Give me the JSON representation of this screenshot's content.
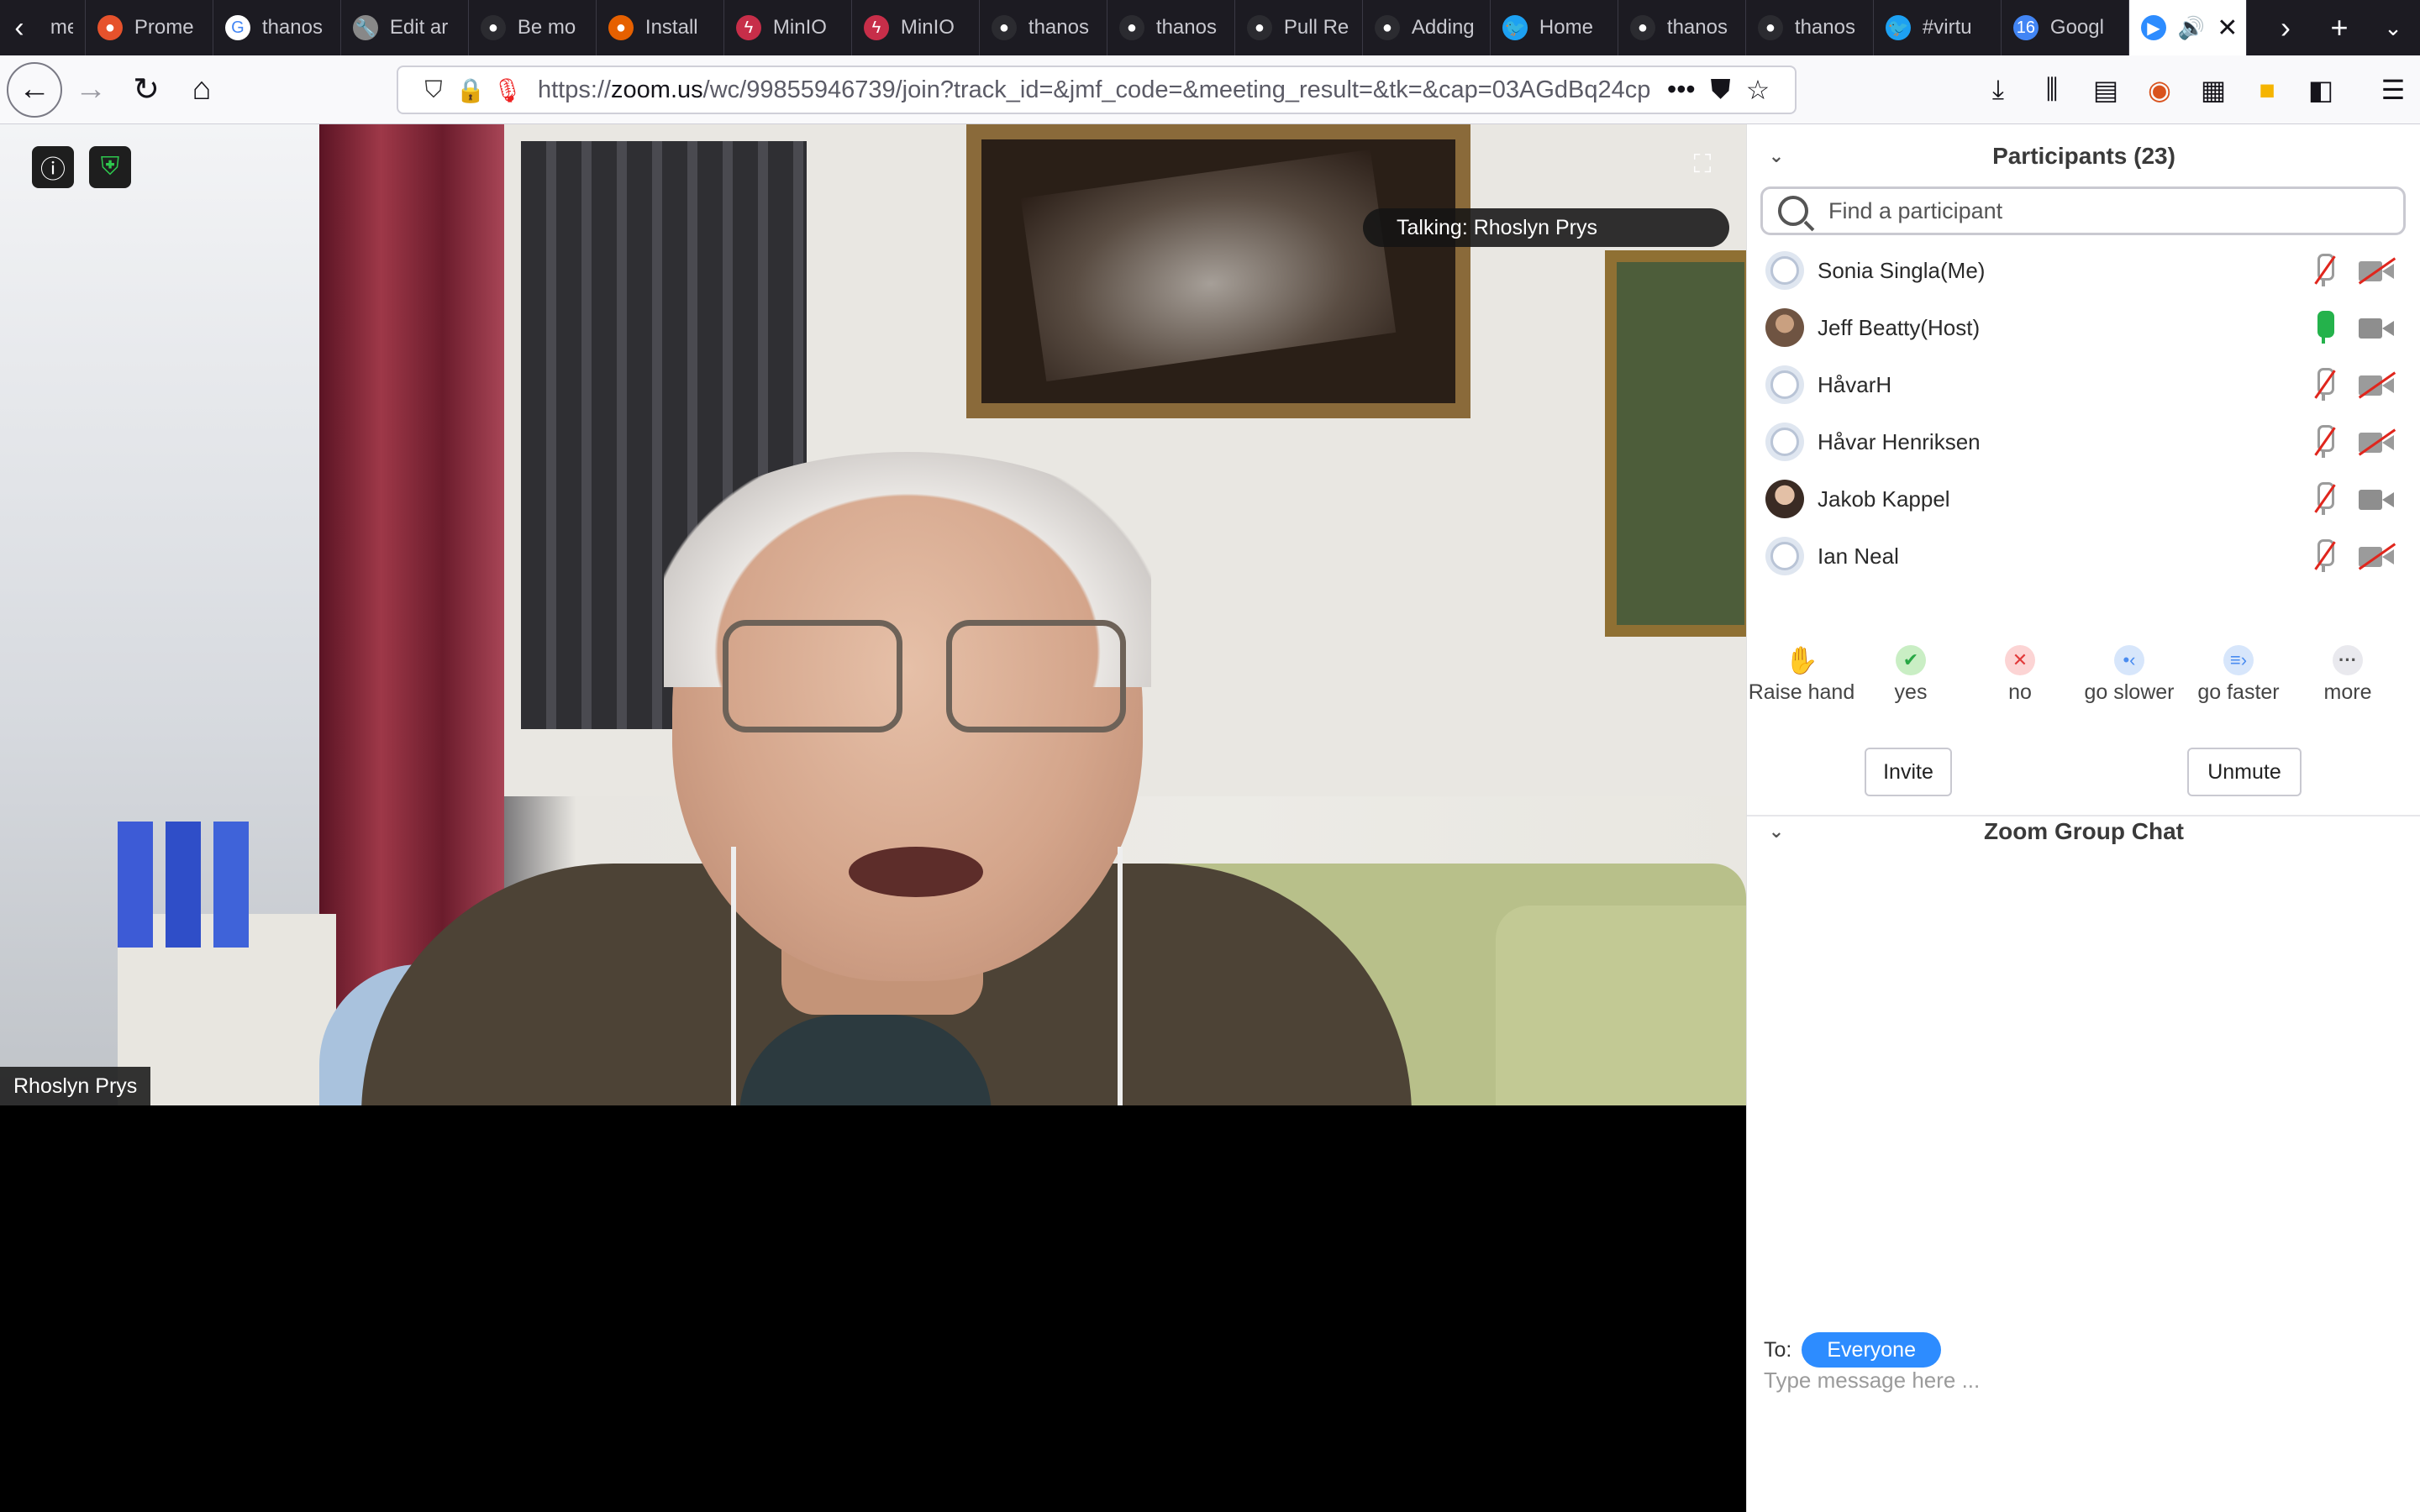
{
  "browser": {
    "tabs": [
      {
        "label": "me",
        "icon": "firefox-icon"
      },
      {
        "label": "Prome",
        "icon": "prometheus-icon"
      },
      {
        "label": "thanos",
        "icon": "google-icon"
      },
      {
        "label": "Edit ar",
        "icon": "wrench-icon"
      },
      {
        "label": "Be mo",
        "icon": "github-icon"
      },
      {
        "label": "Install",
        "icon": "firefox-icon"
      },
      {
        "label": "MinIO",
        "icon": "minio-icon"
      },
      {
        "label": "MinIO",
        "icon": "minio-icon"
      },
      {
        "label": "thanos",
        "icon": "github-icon"
      },
      {
        "label": "thanos",
        "icon": "github-icon"
      },
      {
        "label": "Pull Re",
        "icon": "github-icon"
      },
      {
        "label": "Adding",
        "icon": "github-icon"
      },
      {
        "label": "Home",
        "icon": "twitter-icon"
      },
      {
        "label": "thanos",
        "icon": "github-icon"
      },
      {
        "label": "thanos",
        "icon": "github-icon"
      },
      {
        "label": "#virtu",
        "icon": "twitter-icon"
      },
      {
        "label": "Googl",
        "icon": "calendar-icon"
      }
    ],
    "active_tab": {
      "label": "",
      "icon": "zoom-icon"
    },
    "url_prefix": "https://",
    "url_domain": "zoom.us",
    "url_rest": "/wc/99855946739/join?track_id=&jmf_code=&meeting_result=&tk=&cap=03AGdBq24cp"
  },
  "meeting": {
    "talking_label": "Talking: Rhoslyn Prys",
    "speaker_name": "Rhoslyn Prys"
  },
  "participants": {
    "title": "Participants (23)",
    "search_placeholder": "Find a participant",
    "list": [
      {
        "name": "Sonia Singla(Me)",
        "mic": "muted",
        "video": "off",
        "avatar": "default"
      },
      {
        "name": "Jeff Beatty(Host)",
        "mic": "on",
        "video": "on",
        "avatar": "photo"
      },
      {
        "name": "HåvarH",
        "mic": "muted",
        "video": "off",
        "avatar": "default"
      },
      {
        "name": "Håvar Henriksen",
        "mic": "muted",
        "video": "off",
        "avatar": "default"
      },
      {
        "name": "Jakob Kappel",
        "mic": "muted",
        "video": "on",
        "avatar": "photo"
      },
      {
        "name": "Ian Neal",
        "mic": "muted",
        "video": "off",
        "avatar": "default"
      }
    ],
    "reactions": [
      {
        "label": "Raise hand",
        "icon": "raise-hand-icon"
      },
      {
        "label": "yes",
        "icon": "check-icon"
      },
      {
        "label": "no",
        "icon": "x-icon"
      },
      {
        "label": "go slower",
        "icon": "slower-icon"
      },
      {
        "label": "go faster",
        "icon": "faster-icon"
      },
      {
        "label": "more",
        "icon": "more-icon"
      }
    ],
    "invite_label": "Invite",
    "unmute_label": "Unmute"
  },
  "chat": {
    "title": "Zoom Group Chat",
    "to_label": "To:",
    "recipient": "Everyone",
    "input_placeholder": "Type message here ..."
  },
  "colors": {
    "accent": "#2d8cff",
    "mic_on": "#24b24b",
    "muted": "#e0261d"
  }
}
